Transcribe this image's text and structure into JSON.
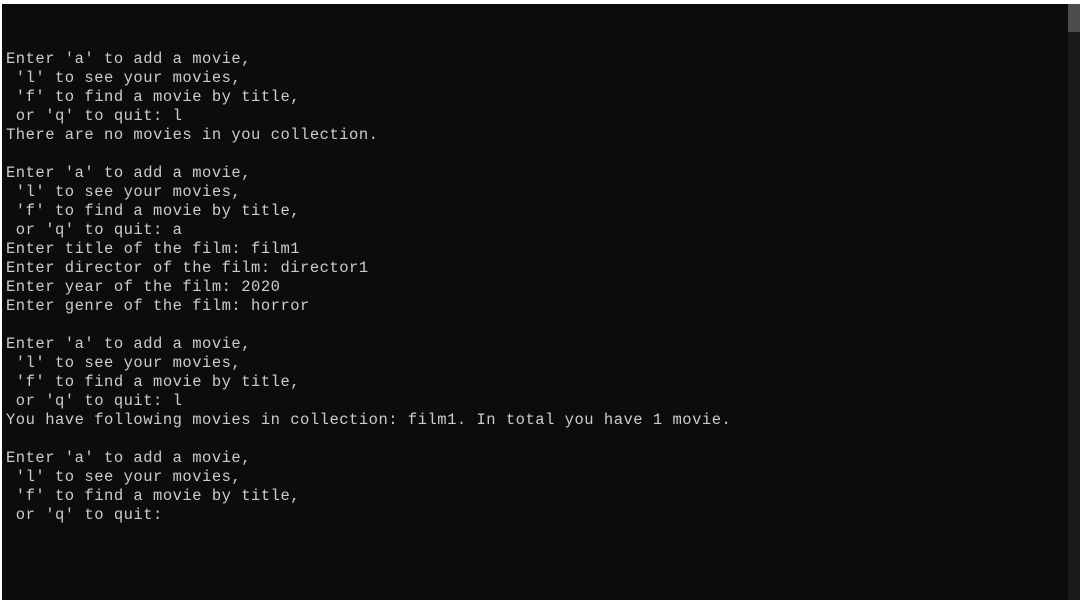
{
  "session": {
    "blocks": [
      {
        "lines": [
          "Enter 'a' to add a movie,",
          " 'l' to see your movies,",
          " 'f' to find a movie by title,",
          " or 'q' to quit: l",
          "There are no movies in you collection."
        ]
      },
      {
        "lines": [
          "Enter 'a' to add a movie,",
          " 'l' to see your movies,",
          " 'f' to find a movie by title,",
          " or 'q' to quit: a",
          "Enter title of the film: film1",
          "Enter director of the film: director1",
          "Enter year of the film: 2020",
          "Enter genre of the film: horror"
        ]
      },
      {
        "lines": [
          "Enter 'a' to add a movie,",
          " 'l' to see your movies,",
          " 'f' to find a movie by title,",
          " or 'q' to quit: l",
          "You have following movies in collection: film1. In total you have 1 movie."
        ]
      },
      {
        "lines": [
          "Enter 'a' to add a movie,",
          " 'l' to see your movies,",
          " 'f' to find a movie by title,",
          " or 'q' to quit: "
        ]
      }
    ]
  }
}
